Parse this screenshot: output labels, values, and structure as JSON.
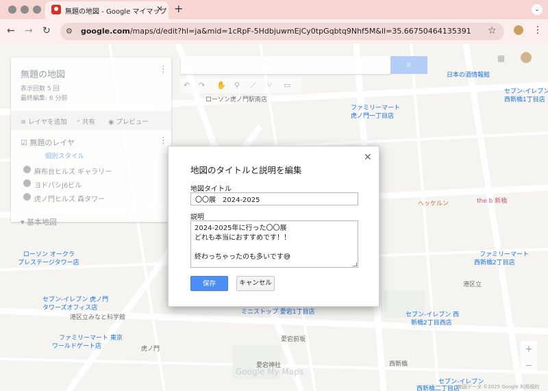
{
  "browser": {
    "tab_title": "無題の地図 - Google マイマップ",
    "close_glyph": "✕",
    "new_tab_glyph": "+",
    "url_domain": "google.com",
    "url_rest": "/maps/d/edit?hl=ja&mid=1cRpF-5HdbjuwmEjCy0tpGqbtq9Nhf5M&ll=35.667504641353915%2C139.7..."
  },
  "panel": {
    "map_title": "無題の地図",
    "views": "表示回数 5 回",
    "last_edit": "最終編集: 6 分前",
    "add_layer": "レイヤを追加",
    "share": "共有",
    "preview": "プレビュー",
    "layer_name": "無題のレイヤ",
    "layer_style": "個別スタイル",
    "places": [
      "麻布台ヒルズ ギャラリー",
      "ヨドバシJ6ビル",
      "虎ノ門ヒルズ 森タワー"
    ],
    "base_map": "基本地図"
  },
  "map": {
    "labels": [
      {
        "text": "ローソン虎ノ門駅南店",
        "cls": "grey"
      },
      {
        "text": "ファミリーマート",
        "cls": ""
      },
      {
        "text": "虎ノ門一丁目店",
        "cls": ""
      },
      {
        "text": "日本の酒情報館",
        "cls": ""
      },
      {
        "text": "セブン-イレブン",
        "cls": ""
      },
      {
        "text": "西新橋1丁目店",
        "cls": ""
      },
      {
        "text": "ヘッケルン",
        "cls": "orange"
      },
      {
        "text": "the b 新橋",
        "cls": "pink"
      },
      {
        "text": "ローソン オークラ",
        "cls": ""
      },
      {
        "text": "プレステージタワー店",
        "cls": ""
      },
      {
        "text": "セブン-イレブン 虎ノ門",
        "cls": ""
      },
      {
        "text": "タワーズオフィス店",
        "cls": ""
      },
      {
        "text": "港区立みなと科学館",
        "cls": "grey"
      },
      {
        "text": "ファミリーマート 東京",
        "cls": ""
      },
      {
        "text": "ワールドゲート店",
        "cls": ""
      },
      {
        "text": "愛宕神社",
        "cls": "grey"
      },
      {
        "text": "西新橋",
        "cls": "grey"
      },
      {
        "text": "ミニストップ 愛宕1丁目店",
        "cls": ""
      },
      {
        "text": "セブン-イレブン 西",
        "cls": ""
      },
      {
        "text": "新橋2丁目西店",
        "cls": ""
      },
      {
        "text": "港区立",
        "cls": "grey"
      },
      {
        "text": "虎ノ門",
        "cls": "grey"
      },
      {
        "text": "愛宕前坂",
        "cls": "grey"
      },
      {
        "text": "ファミリーマート",
        "cls": ""
      },
      {
        "text": "西新橋2丁目店",
        "cls": ""
      },
      {
        "text": "セブン-イレブン",
        "cls": ""
      },
      {
        "text": "西新橋二丁目店",
        "cls": ""
      }
    ],
    "watermark": "Google My Maps",
    "attribution": "地図データ ©2025 Google   利用規約"
  },
  "dialog": {
    "title": "地図のタイトルと説明を編集",
    "title_label": "地図タイトル",
    "title_value": "〇〇展　2024-2025",
    "desc_label": "説明",
    "desc_lines": [
      "2024-2025年に行った〇〇展",
      "どれも本当におすすめです！！",
      "",
      "終わっちゃったのも多いです😅"
    ],
    "save": "保存",
    "cancel": "キャンセル",
    "close_glyph": "✕"
  },
  "colors": {
    "save_button": "#4d8ef7",
    "tab_bar": "#f6d5d3",
    "favicon": "#d93025"
  }
}
